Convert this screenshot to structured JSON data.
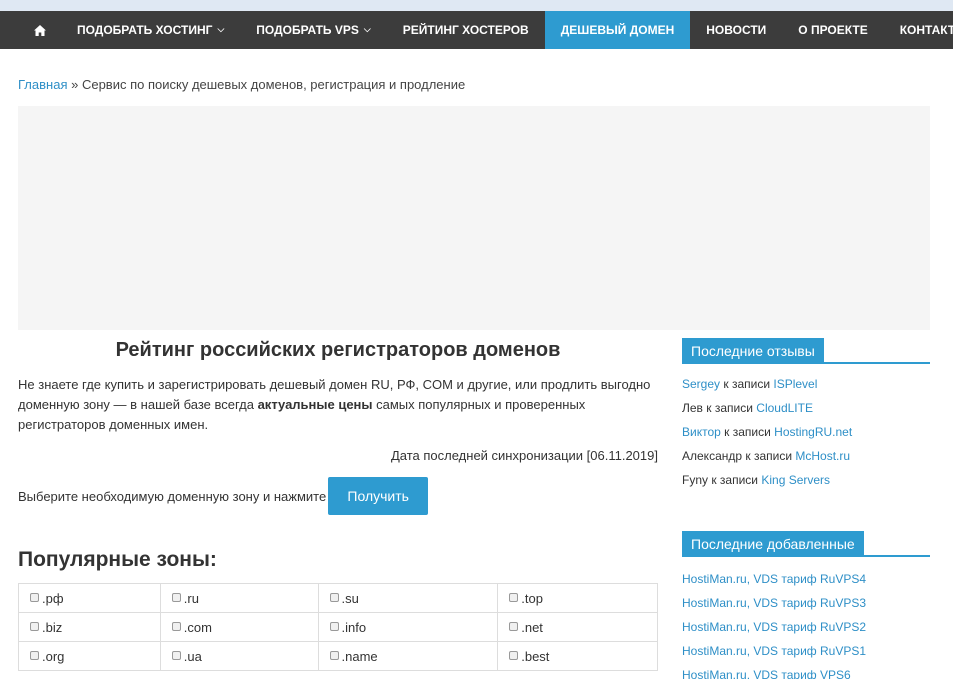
{
  "nav": {
    "home_icon": "home-icon",
    "items": [
      {
        "label": "ПОДОБРАТЬ ХОСТИНГ",
        "dropdown": true
      },
      {
        "label": "ПОДОБРАТЬ VPS",
        "dropdown": true
      },
      {
        "label": "РЕЙТИНГ ХОСТЕРОВ",
        "dropdown": false
      },
      {
        "label": "ДЕШЕВЫЙ ДОМЕН",
        "dropdown": false,
        "active": true
      },
      {
        "label": "НОВОСТИ",
        "dropdown": false
      },
      {
        "label": "О ПРОЕКТЕ",
        "dropdown": false
      },
      {
        "label": "КОНТАКТЫ",
        "dropdown": false
      }
    ],
    "chevron": "⌄"
  },
  "breadcrumb": {
    "home": "Главная",
    "separator": " » ",
    "current": "Сервис по поиску дешевых доменов, регистрация и продление"
  },
  "main": {
    "title": "Рейтинг российских регистраторов доменов",
    "intro_before": "Не знаете где купить и зарегистрировать дешевый домен RU, РФ, COM и другие, или продлить выгодно доменную зону — в нашей базе всегда ",
    "intro_bold": "актуальные цены",
    "intro_after": " самых популярных и проверенных регистраторов доменных имен.",
    "sync": "Дата последней синхронизации [06.11.2019]",
    "choose_text": "Выберите необходимую доменную зону и нажмите",
    "get_button": "Получить",
    "popular_title": "Популярные зоны:",
    "zones": [
      [
        ".рф",
        ".ru",
        ".su",
        ".top"
      ],
      [
        ".biz",
        ".com",
        ".info",
        ".net"
      ],
      [
        ".org",
        ".ua",
        ".name",
        ".best"
      ]
    ]
  },
  "sidebar": {
    "reviews_title": "Последние отзывы",
    "reviews": [
      {
        "author": "Sergey",
        "author_link": true,
        "middle": " к записи ",
        "target": "ISPlevel"
      },
      {
        "author": "Лев",
        "author_link": false,
        "middle": " к записи ",
        "target": "CloudLITE"
      },
      {
        "author": "Виктор",
        "author_link": true,
        "middle": " к записи ",
        "target": "HostingRU.net"
      },
      {
        "author": "Александр",
        "author_link": false,
        "middle": " к записи ",
        "target": "McHost.ru"
      },
      {
        "author": "Fyny",
        "author_link": false,
        "middle": " к записи ",
        "target": "King Servers"
      }
    ],
    "added_title": "Последние добавленные",
    "added": [
      "HostiMan.ru, VDS тариф RuVPS4",
      "HostiMan.ru, VDS тариф RuVPS3",
      "HostiMan.ru, VDS тариф RuVPS2",
      "HostiMan.ru, VDS тариф RuVPS1",
      "HostiMan.ru, VDS тариф VPS6"
    ]
  },
  "colors": {
    "nav_bg": "#3c3c3c",
    "accent": "#2e9bd0",
    "link": "#2e8fc7"
  }
}
